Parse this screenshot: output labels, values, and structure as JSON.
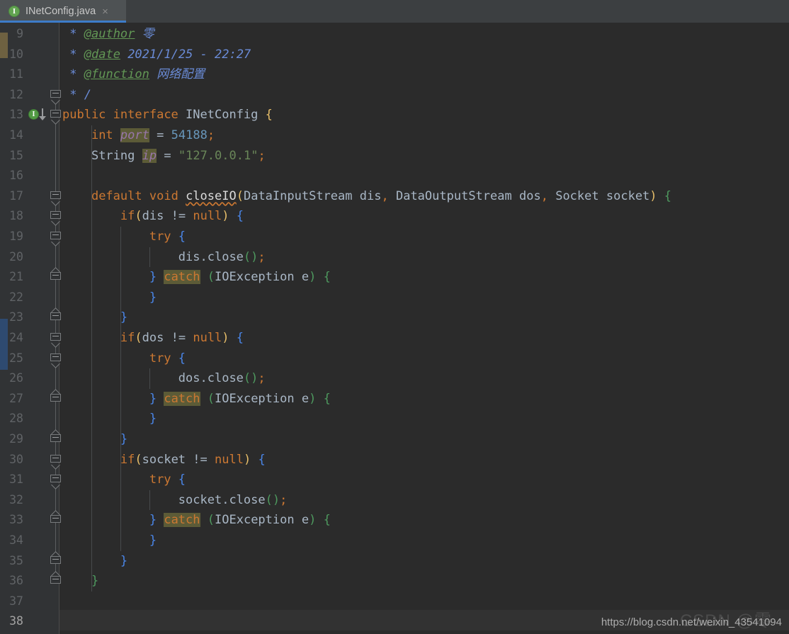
{
  "window": {
    "theme": "darcula",
    "colors": {
      "editor_bg": "#2b2b2b",
      "gutter_bg": "#313335",
      "caret_row_bg": "#323232",
      "tab_active_bg": "#4e5254",
      "tab_bar_bg": "#3c3f41",
      "tab_underline": "#3d7cc9",
      "keyword": "#cc7832",
      "string": "#6a8759",
      "number": "#6897bb",
      "field": "#9876aa",
      "comment": "#6a8bd6",
      "javadoc_tag": "#629755",
      "identifier": "#a9b7c6",
      "highlight_bg": "#5c5b37"
    }
  },
  "tab": {
    "icon": "interface-icon",
    "icon_letter": "I",
    "label": "INetConfig.java",
    "close": "×"
  },
  "gutter": {
    "first_line": 9,
    "last_line": 38,
    "current_line": 38,
    "line_numbers": [
      "9",
      "10",
      "11",
      "12",
      "13",
      "14",
      "15",
      "16",
      "17",
      "18",
      "19",
      "20",
      "21",
      "22",
      "23",
      "24",
      "25",
      "26",
      "27",
      "28",
      "29",
      "30",
      "31",
      "32",
      "33",
      "34",
      "35",
      "36",
      "37",
      "38"
    ],
    "marker_line": 13,
    "marker_type": "implemented-by-icon",
    "marker_letter": "I",
    "fold_down_lines": [
      12,
      13,
      17,
      18,
      19,
      24,
      25,
      30,
      31
    ],
    "fold_up_lines": [
      21,
      23,
      27,
      29,
      33,
      35,
      36
    ]
  },
  "code": {
    "language": "Java",
    "lines": [
      {
        "n": 9,
        "text": " * @author 零"
      },
      {
        "n": 10,
        "text": " * @date 2021/1/25 - 22:27"
      },
      {
        "n": 11,
        "text": " * @function 网络配置"
      },
      {
        "n": 12,
        "text": " */"
      },
      {
        "n": 13,
        "text": "public interface INetConfig {"
      },
      {
        "n": 14,
        "text": "    int port = 54188;"
      },
      {
        "n": 15,
        "text": "    String ip = \"127.0.0.1\";"
      },
      {
        "n": 16,
        "text": ""
      },
      {
        "n": 17,
        "text": "    default void closeIO(DataInputStream dis, DataOutputStream dos, Socket socket) {"
      },
      {
        "n": 18,
        "text": "        if(dis != null) {"
      },
      {
        "n": 19,
        "text": "            try {"
      },
      {
        "n": 20,
        "text": "                dis.close();"
      },
      {
        "n": 21,
        "text": "            } catch (IOException e) {"
      },
      {
        "n": 22,
        "text": "            }"
      },
      {
        "n": 23,
        "text": "        }"
      },
      {
        "n": 24,
        "text": "        if(dos != null) {"
      },
      {
        "n": 25,
        "text": "            try {"
      },
      {
        "n": 26,
        "text": "                dos.close();"
      },
      {
        "n": 27,
        "text": "            } catch (IOException e) {"
      },
      {
        "n": 28,
        "text": "            }"
      },
      {
        "n": 29,
        "text": "        }"
      },
      {
        "n": 30,
        "text": "        if(socket != null) {"
      },
      {
        "n": 31,
        "text": "            try {"
      },
      {
        "n": 32,
        "text": "                socket.close();"
      },
      {
        "n": 33,
        "text": "            } catch (IOException e) {"
      },
      {
        "n": 34,
        "text": "            }"
      },
      {
        "n": 35,
        "text": "        }"
      },
      {
        "n": 36,
        "text": "    }"
      },
      {
        "n": 37,
        "text": ""
      },
      {
        "n": 38,
        "text": ""
      }
    ],
    "javadoc": {
      "author_tag": "@author",
      "author_value": "零",
      "date_tag": "@date",
      "date_value": "2021/1/25 - 22:27",
      "function_tag": "@function",
      "function_value": "网络配置"
    },
    "declaration": {
      "modifier": "public",
      "kind": "interface",
      "name": "INetConfig"
    },
    "fields": [
      {
        "type": "int",
        "name": "port",
        "value": "54188"
      },
      {
        "type": "String",
        "name": "ip",
        "value": "\"127.0.0.1\""
      }
    ],
    "method": {
      "modifier": "default",
      "return_type": "void",
      "name": "closeIO",
      "params": [
        {
          "type": "DataInputStream",
          "name": "dis"
        },
        {
          "type": "DataOutputStream",
          "name": "dos"
        },
        {
          "type": "Socket",
          "name": "socket"
        }
      ],
      "catch_type": "IOException",
      "catch_var": "e"
    }
  },
  "watermark": {
    "url": "https://blog.csdn.net/weixin_43541094",
    "ghost": "CSDN @零"
  }
}
